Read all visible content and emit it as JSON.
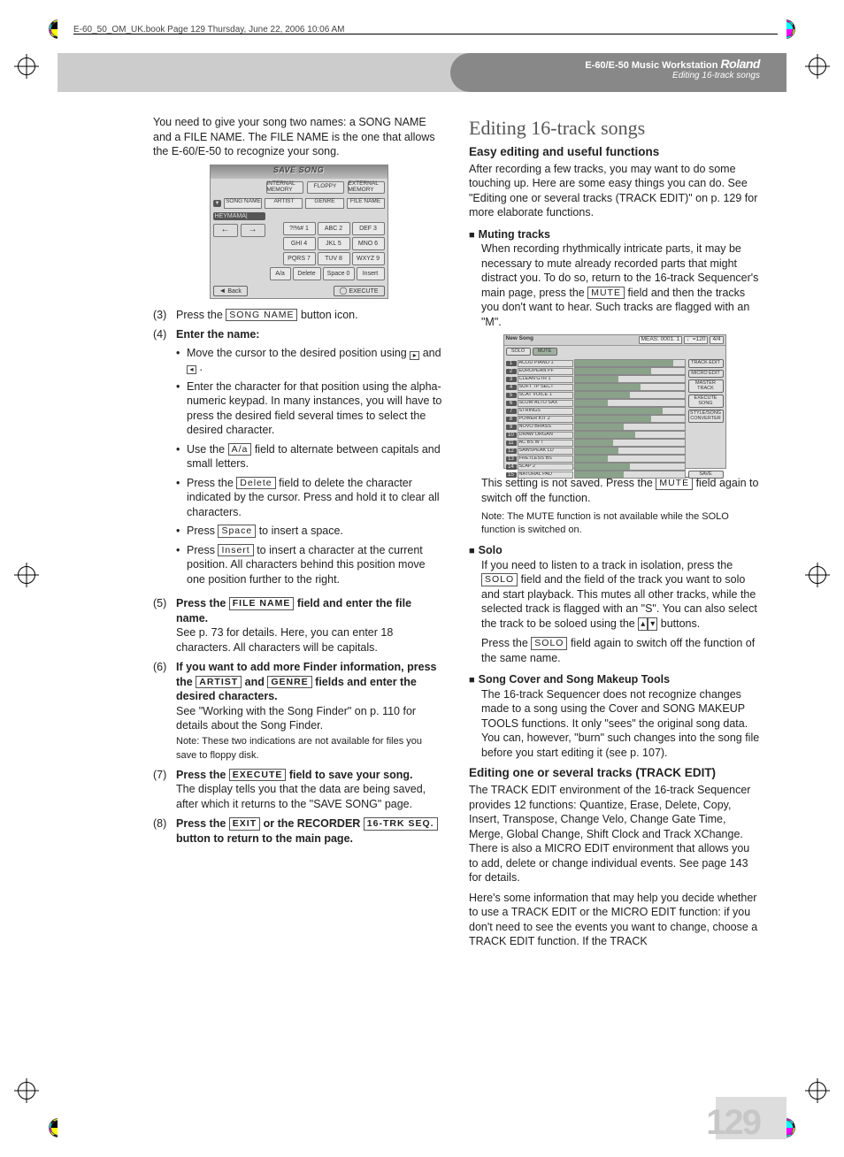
{
  "book_header": "E-60_50_OM_UK.book  Page 129  Thursday, June 22, 2006  10:06 AM",
  "header": {
    "product": "E-60/E-50 Music Workstation",
    "brand": "Roland",
    "doc_section": "Editing 16-track songs"
  },
  "left": {
    "intro": "You need to give your song two names: a SONG NAME and a FILE NAME. The FILE NAME is the one that allows the E-60/E-50 to recognize your song.",
    "save_song": {
      "title": "SAVE SONG",
      "tabs": [
        "INTERNAL MEMORY",
        "FLOPPY",
        "EXTERNAL MEMORY"
      ],
      "fields": [
        "SONG NAME",
        "ARTIST",
        "GENRE",
        "FILE NAME"
      ],
      "name_value": "HEYMAMA|",
      "keys": [
        "?!%# 1",
        "ABC 2",
        "DEF 3",
        "GHI 4",
        "JKL 5",
        "MNO 6",
        "PQRS 7",
        "TUV 8",
        "WXYZ 9",
        "A/a",
        "Delete",
        "Space 0",
        "Insert"
      ],
      "arrows": [
        "←",
        "→"
      ],
      "back": "Back",
      "execute": "EXECUTE"
    },
    "step3_pre": "Press the ",
    "step3_btn": "SONG NAME",
    "step3_post": " button icon.",
    "step4": "Enter the name:",
    "b1_pre": "Move the cursor to the desired position using ",
    "b1_mid": " and ",
    "b1_end": ".",
    "b2": "Enter the character for that position using the alpha-numeric keypad. In many instances, you will have to press the desired field several times to select the desired character.",
    "b3_pre": "Use the ",
    "b3_btn": "A/a",
    "b3_post": " field to alternate between capitals and small letters.",
    "b4_pre": "Press the ",
    "b4_btn": "Delete",
    "b4_post": " field to delete the character indicated by the cursor. Press and hold it to clear all characters.",
    "b5_pre": "Press ",
    "b5_btn": "Space",
    "b5_post": " to insert a space.",
    "b6_pre": "Press ",
    "b6_btn": "Insert",
    "b6_post": " to insert a character at the current position. All characters behind this position move one position further to the right.",
    "step5_pre": "Press the ",
    "step5_btn": "FILE NAME",
    "step5_mid": " field and enter the file name.",
    "step5_body": "See p. 73 for details. Here, you can enter 18 characters. All characters will be capitals.",
    "step6_pre": "If you want to add more Finder information, press the ",
    "step6_b1": "ARTIST",
    "step6_and": " and ",
    "step6_b2": "GENRE",
    "step6_post": " fields and enter the desired characters.",
    "step6_body": "See \"Working with the Song Finder\" on p. 110 for details about the Song Finder.",
    "step6_note": "Note: These two indications are not available for files you save to floppy disk.",
    "step7_pre": "Press the ",
    "step7_btn": "EXECUTE",
    "step7_post": " field to save your song.",
    "step7_body": "The display tells you that the data are being saved, after which it returns to the \"SAVE SONG\" page.",
    "step8_pre": "Press the ",
    "step8_b1": "EXIT",
    "step8_mid": " or the RECORDER ",
    "step8_b2": "16-TRK SEQ.",
    "step8_post": " button to return to the main page."
  },
  "right": {
    "title": "Editing 16-track songs",
    "easy_head": "Easy editing and useful functions",
    "easy_body": "After recording a few tracks, you may want to do some touching up. Here are some easy things you can do. See \"Editing one or several tracks (TRACK EDIT)\" on p. 129 for more elaborate functions.",
    "mute_head": "Muting tracks",
    "mute_body_pre": "When recording rhythmically intricate parts, it may be necessary to mute already recorded parts that might distract you. To do so, return to the 16-track Sequencer's main page, press the ",
    "mute_btn": "MUTE",
    "mute_body_post": " field and then the tracks you don't want to hear. Such tracks are flagged with an \"M\".",
    "track_shot": {
      "title": "New Song",
      "meas": "MEAS: 0001. 1",
      "tempo": "♩=120",
      "sig": "4/4",
      "top_btns": [
        "SOLO",
        "MUTE"
      ],
      "side_btns": [
        "TRACK EDIT",
        "MICRO EDIT",
        "MASTER TRACK",
        "EXECUTE SONG",
        "STYLE/SONG CONVERTER",
        "SAVE"
      ],
      "tracks": [
        "ACOU PIANO 1",
        "EUROPEAN PF",
        "CLEAN GTR 1",
        "SOFT TP SECT",
        "SCAT VOICE 1",
        "SLOW ALTO SAX",
        "STRINGS",
        "POWER KIT 2",
        "NOVO BRASS",
        "DRAW ORGAN",
        "AC BS W T",
        "SAWSPEAK LD",
        "FRETLESS BS",
        "SLAP 2",
        "NATURAL PAD"
      ]
    },
    "mute2_pre": "This setting is not saved. Press the ",
    "mute2_btn": "MUTE",
    "mute2_post": " field again to switch off the function.",
    "mute_note": "Note: The MUTE function is not available while the SOLO function is switched on.",
    "solo_head": "Solo",
    "solo_pre": "If you need to listen to a track in isolation, press the ",
    "solo_btn": "SOLO",
    "solo_mid": " field and the field of the track you want to solo and start playback. This mutes all other tracks, while the selected track is flagged with an \"S\". You can also select the track to be soloed using the ",
    "solo_post": " buttons.",
    "solo2_pre": "Press the ",
    "solo2_btn": "SOLO",
    "solo2_post": " field again to switch off the function of the same name.",
    "cover_head": "Song Cover and Song Makeup Tools",
    "cover_body": "The 16-track Sequencer does not recognize changes made to a song using the Cover and SONG MAKEUP TOOLS functions. It only \"sees\" the original song data. You can, however, \"burn\" such changes into the song file before you start editing it (see p. 107).",
    "edit_head": "Editing one or several tracks (TRACK EDIT)",
    "edit_body1": "The TRACK EDIT environment of the 16-track Sequencer provides 12 functions: Quantize, Erase, Delete, Copy, Insert, Transpose, Change Velo, Change Gate Time, Merge, Global Change, Shift Clock and Track XChange. There is also a MICRO EDIT environment that allows you to add, delete or change individual events. See page 143 for details.",
    "edit_body2": "Here's some information that may help you decide whether to use a TRACK EDIT or the MICRO EDIT function: if you don't need to see the events you want to change, choose a TRACK EDIT function. If the TRACK"
  },
  "page_number": "129"
}
